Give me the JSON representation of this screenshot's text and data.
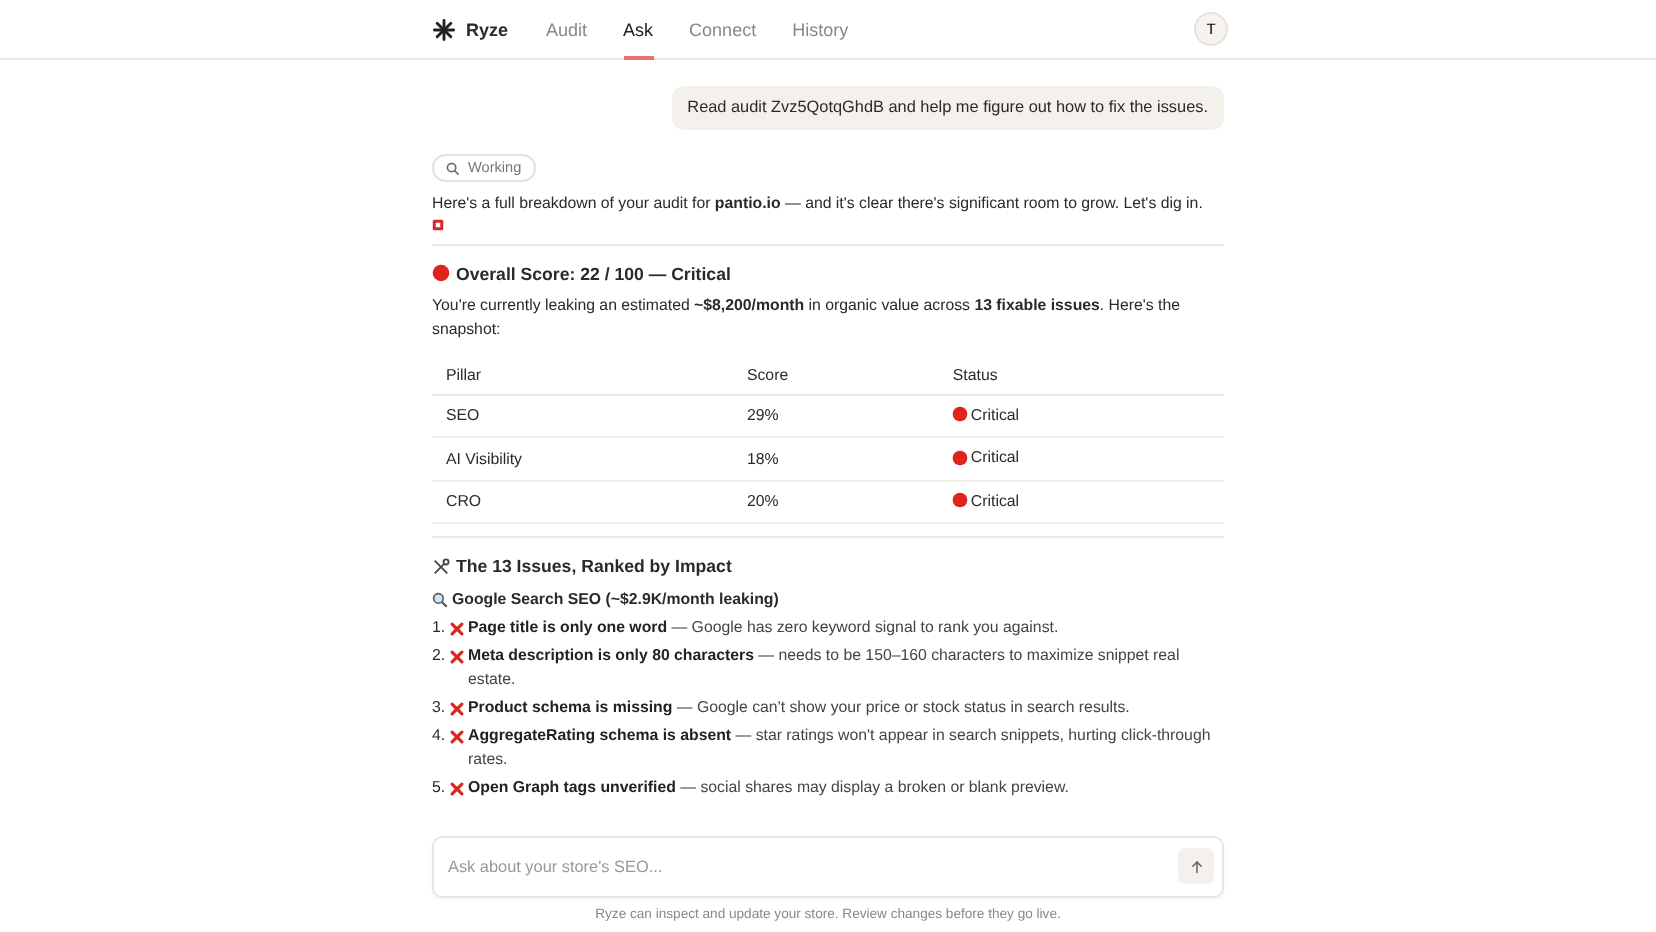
{
  "app": {
    "name": "Ryze",
    "avatar": "T"
  },
  "nav": [
    {
      "label": "Audit",
      "selected": false
    },
    {
      "label": "Ask",
      "selected": true
    },
    {
      "label": "Connect",
      "selected": false
    },
    {
      "label": "History",
      "selected": false
    }
  ],
  "user_message": "Read audit Zvz5QotqGhdB and help me figure out how to fix the issues.",
  "status_pill": "Working",
  "intro": "Here's a full breakdown of your audit for **pantio.io** — and it's clear there's significant room to grow. Let's dig in.",
  "score_heading": "Overall Score: 22 / 100 — Critical",
  "summary": "You're currently leaking an estimated **~$8,200/month** in organic value across **13 fixable issues**. Here's the snapshot:",
  "table": {
    "columns": [
      "Pillar",
      "Score",
      "Status"
    ],
    "rows": [
      {
        "pillar": "SEO",
        "score": "29%",
        "status": "Critical",
        "color": "#e0231c"
      },
      {
        "pillar": "AI Visibility",
        "score": "18%",
        "status": "Critical",
        "color": "#e0231c"
      },
      {
        "pillar": "CRO",
        "score": "20%",
        "status": "Critical",
        "color": "#e0231c"
      }
    ]
  },
  "issues_heading": "The 13 Issues, Ranked by Impact",
  "section_heading": "Google Search SEO (~$2.9K/month leaking)",
  "issues": [
    {
      "number": "1.",
      "title": "Page title is only one word",
      "detail": "— Google has zero keyword signal to rank you against."
    },
    {
      "number": "2.",
      "title": "Meta description is only 80 characters",
      "detail": "— needs to be 150–160 characters to maximize snippet real estate."
    },
    {
      "number": "3.",
      "title": "Product schema is missing",
      "detail": "— Google can't show your price or stock status in search results."
    },
    {
      "number": "4.",
      "title": "AggregateRating schema is absent",
      "detail": "— star ratings won't appear in search snippets, hurting click-through rates."
    },
    {
      "number": "5.",
      "title": "Open Graph tags unverified",
      "detail": "— social shares may display a broken or blank preview."
    }
  ],
  "composer": {
    "placeholder": "Ask about your store's SEO..."
  },
  "footer_note": "Ryze can inspect and update your store. Review changes before they go live."
}
